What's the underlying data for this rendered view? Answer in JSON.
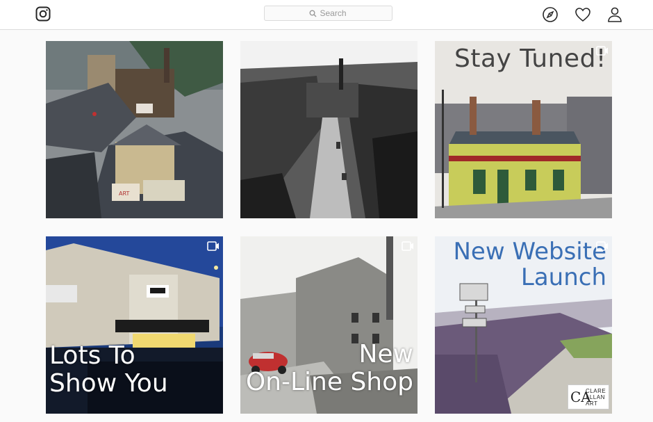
{
  "search": {
    "placeholder": "Search"
  },
  "icons": {
    "logo": "instagram-logo-icon",
    "search": "search-icon",
    "explore": "compass-icon",
    "activity": "heart-icon",
    "profile": "person-icon",
    "video": "video-icon"
  },
  "posts": [
    {
      "overlay": "",
      "video": false
    },
    {
      "overlay": "",
      "video": false
    },
    {
      "overlay": "Stay Tuned!",
      "video": true
    },
    {
      "overlay_line1": "Lots To",
      "overlay_line2": "Show You",
      "video": true
    },
    {
      "overlay_line1": "New",
      "overlay_line2": "On-Line Shop",
      "video": true
    },
    {
      "overlay_line1": "New Website",
      "overlay_line2": "Launch",
      "video": true,
      "badge_mark": "CA",
      "badge_line1": "CLARE",
      "badge_line2": "ALLAN",
      "badge_line3": "ART"
    }
  ],
  "colors": {
    "topbar_bg": "#ffffff",
    "page_bg": "#fafafa",
    "border": "#dbdbdb",
    "website_text": "#3a6fb5"
  }
}
